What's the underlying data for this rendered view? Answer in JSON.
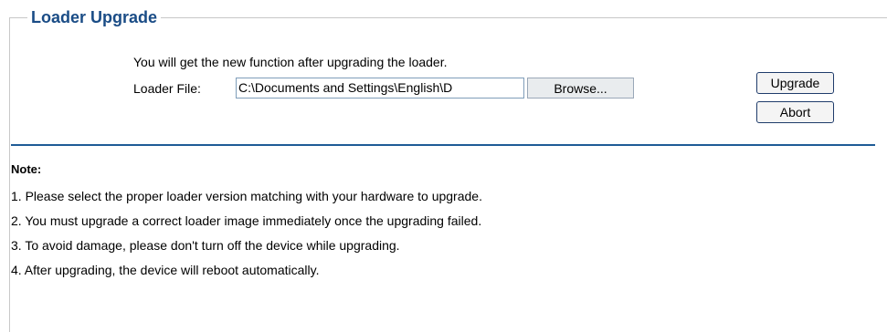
{
  "panel": {
    "title": "Loader Upgrade"
  },
  "form": {
    "description": "You will get the new function after upgrading the loader.",
    "file_label": "Loader File:",
    "file_value": "C:\\Documents and Settings\\English\\D",
    "browse_label": "Browse...",
    "upgrade_label": "Upgrade",
    "abort_label": "Abort"
  },
  "notes": {
    "heading": "Note:",
    "items": [
      "1. Please select the proper loader version matching with your hardware to upgrade.",
      "2. You must upgrade a correct loader image immediately once the upgrading failed.",
      "3. To avoid damage, please don't turn off the device while upgrading.",
      "4. After upgrading, the device will reboot automatically."
    ]
  },
  "colors": {
    "title": "#1a4c86",
    "divider": "#1e5b96"
  }
}
